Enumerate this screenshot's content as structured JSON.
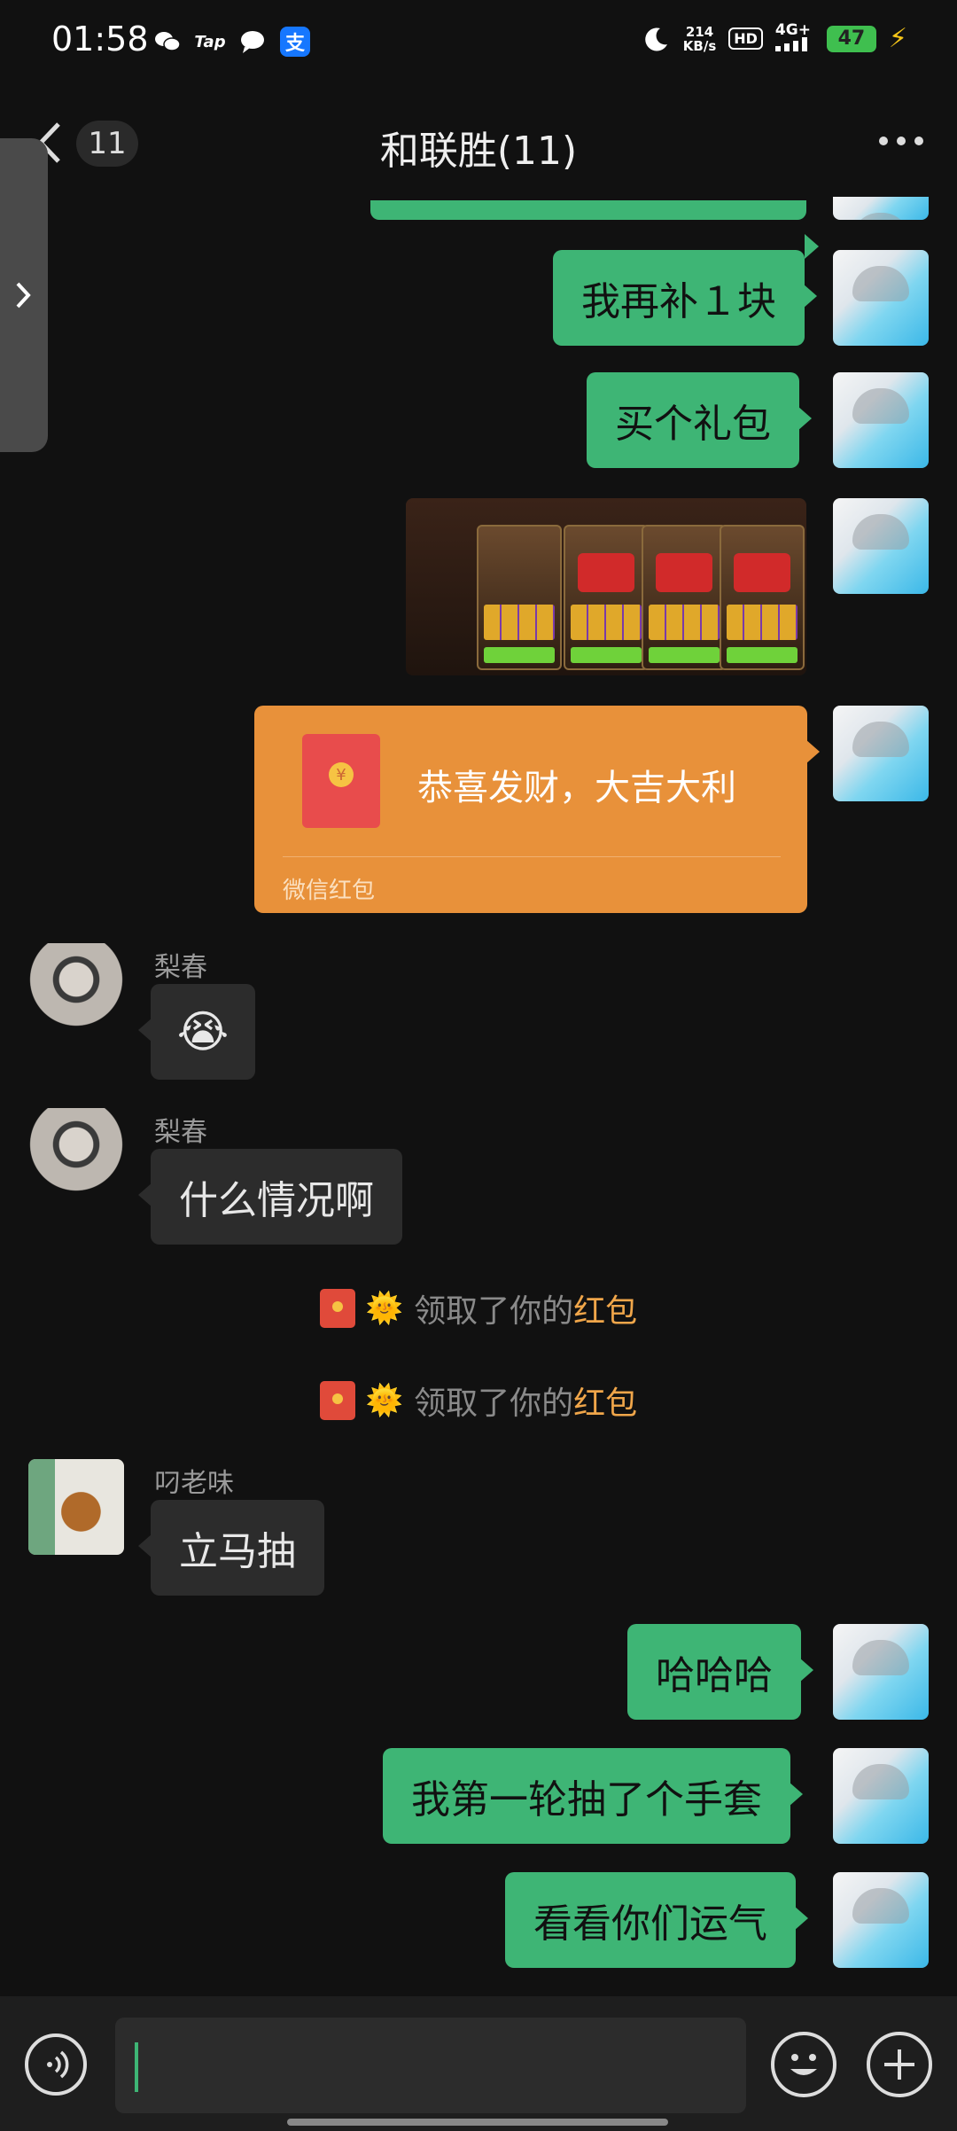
{
  "status_bar": {
    "time": "01:58",
    "left_icons": [
      "wechat-icon",
      "tap-icon",
      "message-icon",
      "alipay-icon"
    ],
    "tap_label": "Tap",
    "alipay_label": "支",
    "net_speed": "214",
    "net_speed_unit": "KB/s",
    "hd_label": "HD",
    "network_label": "4G+",
    "battery": "47"
  },
  "header": {
    "back_count": "11",
    "title": "和联胜(11)"
  },
  "messages": {
    "m1": "我再补１块",
    "m2": "买个礼包",
    "red_packet": {
      "greeting": "恭喜发财，大吉大利",
      "label": "微信红包"
    },
    "lichun_name_1": "梨春",
    "lichun_name_2": "梨春",
    "lichun_msg": "什么情况啊",
    "emoji_msg": "😭",
    "sys1": {
      "text": "领取了你的",
      "highlight": "红包"
    },
    "sys2": {
      "text": "领取了你的",
      "highlight": "红包"
    },
    "diao_name": "叼老味",
    "diao_msg": "立马抽",
    "m3": "哈哈哈",
    "m4": "我第一轮抽了个手套",
    "m5": "看看你们运气"
  },
  "colors": {
    "outgoing_bubble": "#3eb575",
    "incoming_bubble": "#2c2c2c",
    "red_packet": "#e8913a",
    "highlight": "#f0a64a"
  }
}
